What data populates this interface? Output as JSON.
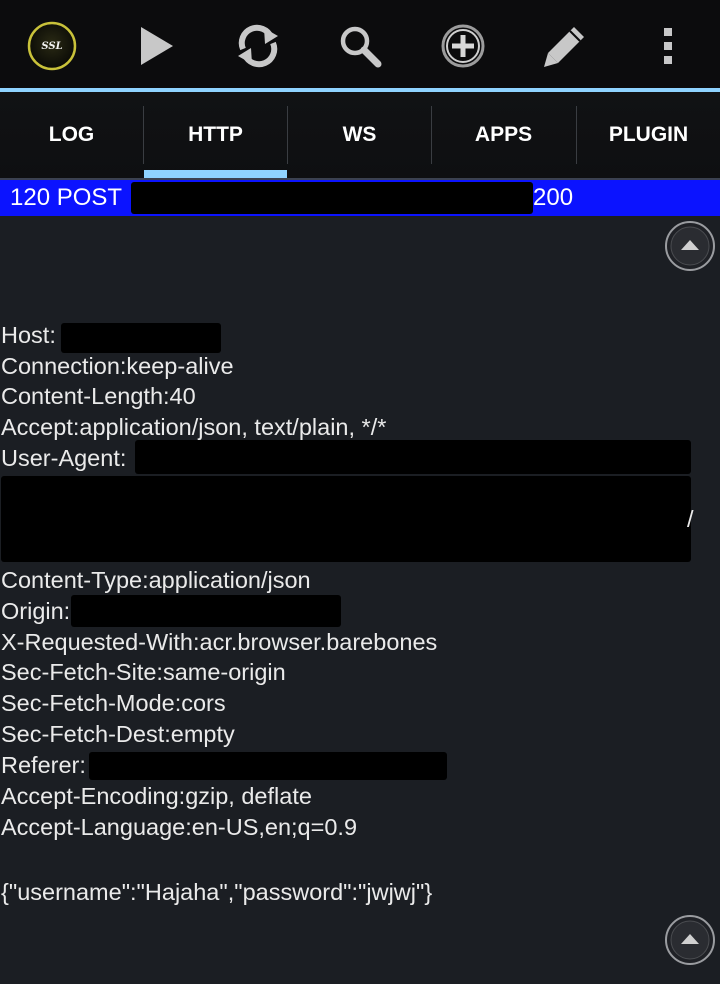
{
  "toolbar": {
    "ssl_badge": "SSL",
    "buttons": [
      {
        "icon": "ssl-badge-icon"
      },
      {
        "icon": "play-icon"
      },
      {
        "icon": "refresh-icon"
      },
      {
        "icon": "search-icon"
      },
      {
        "icon": "add-circle-icon"
      },
      {
        "icon": "pencil-icon"
      },
      {
        "icon": "more-vert-icon"
      }
    ]
  },
  "tabs": [
    {
      "label": "LOG"
    },
    {
      "label": "HTTP",
      "active": true
    },
    {
      "label": "WS"
    },
    {
      "label": "APPS"
    },
    {
      "label": "PLUGIN"
    }
  ],
  "request": {
    "id_method": "120 POST",
    "status": "200"
  },
  "headers": {
    "host": "Host:",
    "connection": "Connection:keep-alive",
    "content_length": "Content-Length:40",
    "accept": "Accept:application/json, text/plain, */*",
    "user_agent": "User-Agent:",
    "user_agent_tail": "/",
    "content_type": "Content-Type:application/json",
    "origin": "Origin:",
    "x_requested_with": "X-Requested-With:acr.browser.barebones",
    "sec_fetch_site": "Sec-Fetch-Site:same-origin",
    "sec_fetch_mode": "Sec-Fetch-Mode:cors",
    "sec_fetch_dest": "Sec-Fetch-Dest:empty",
    "referer": "Referer:",
    "accept_encoding": "Accept-Encoding:gzip, deflate",
    "accept_language": "Accept-Language:en-US,en;q=0.9"
  },
  "body": "{\"username\":\"Hajaha\",\"password\":\"jwjwj\"}",
  "colors": {
    "accent": "#8fd3ff",
    "request_bar": "#0b13ff",
    "background": "#1b1e23",
    "toolbar": "#0c0c0d"
  }
}
